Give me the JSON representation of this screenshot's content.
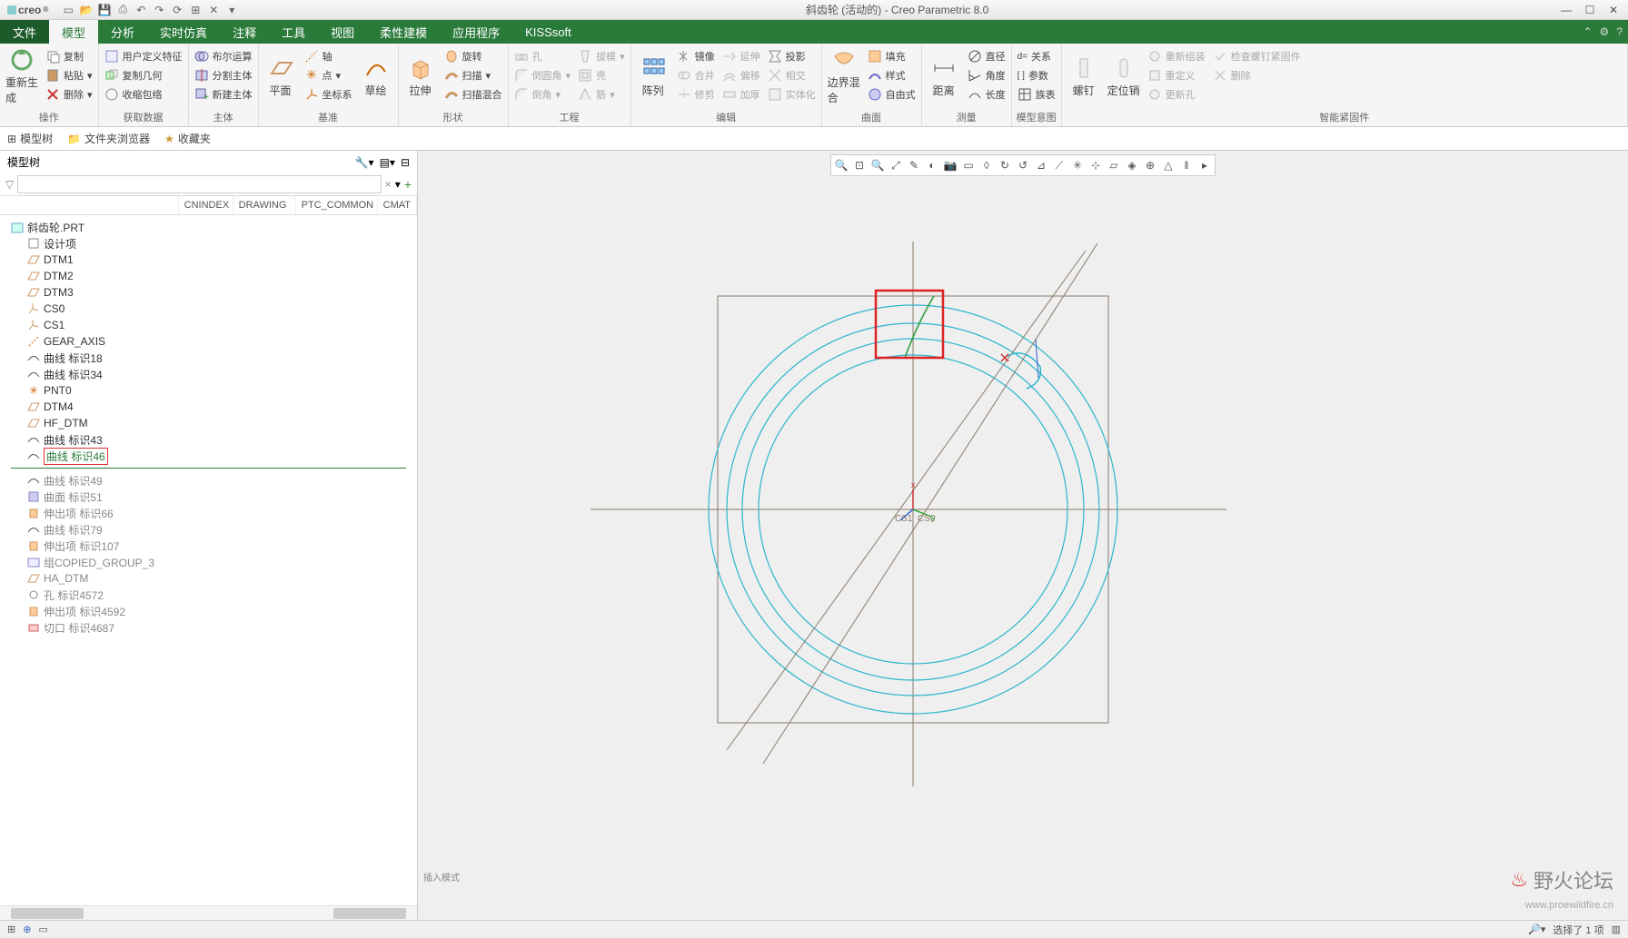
{
  "titlebar": {
    "logo": "creo",
    "title": "斜齿轮 (活动的) - Creo Parametric 8.0"
  },
  "tabs": [
    "文件",
    "模型",
    "分析",
    "实时仿真",
    "注释",
    "工具",
    "视图",
    "柔性建模",
    "应用程序",
    "KISSsoft"
  ],
  "active_tab_index": 1,
  "ribbon": {
    "g1": {
      "big": "重新生成",
      "i1": "复制",
      "i2": "粘贴",
      "i3": "删除",
      "label": "操作"
    },
    "g2": {
      "i1": "用户定义特征",
      "i2": "复制几何",
      "i3": "收缩包络",
      "label": "获取数据"
    },
    "g3": {
      "i1": "布尔运算",
      "i2": "分割主体",
      "i3": "新建主体",
      "label": "主体"
    },
    "g4": {
      "big": "平面",
      "i1": "轴",
      "i2": "点",
      "i3": "坐标系",
      "big2": "草绘",
      "label": "基准"
    },
    "g5": {
      "big": "拉伸",
      "i1": "旋转",
      "i2": "扫描",
      "i3": "扫描混合",
      "label": "形状"
    },
    "g6": {
      "i1": "孔",
      "i2": "倒圆角",
      "i3": "倒角",
      "i4": "拔模",
      "i5": "壳",
      "i6": "筋",
      "label": "工程"
    },
    "g7": {
      "big": "阵列",
      "i1": "镜像",
      "i2": "合并",
      "i3": "修剪",
      "i4": "延伸",
      "i5": "偏移",
      "i6": "加厚",
      "i7": "投影",
      "i8": "相交",
      "i9": "实体化",
      "label": "编辑"
    },
    "g8": {
      "big": "边界混合",
      "i1": "填充",
      "i2": "样式",
      "i3": "自由式",
      "label": "曲面"
    },
    "g9": {
      "big": "距离",
      "i1": "直径",
      "i2": "角度",
      "i3": "长度",
      "label": "测量"
    },
    "g10": {
      "i1": "关系",
      "i2": "参数",
      "i3": "族表",
      "label": "模型意图"
    },
    "g11": {
      "big1": "螺钉",
      "big2": "定位销",
      "i1": "重新组装",
      "i2": "重定义",
      "i3": "检查螺钉紧固件",
      "i4": "删除",
      "i5": "更新孔",
      "label": "智能紧固件"
    }
  },
  "nav": {
    "i1": "模型树",
    "i2": "文件夹浏览器",
    "i3": "收藏夹"
  },
  "sidebar": {
    "title": "模型树",
    "columns": [
      "CNINDEX",
      "DRAWING",
      "PTC_COMMON",
      "CMAT"
    ],
    "root": "斜齿轮.PRT",
    "items": [
      {
        "t": "设计项",
        "lv": 1
      },
      {
        "t": "DTM1",
        "lv": 1,
        "ic": "datum"
      },
      {
        "t": "DTM2",
        "lv": 1,
        "ic": "datum"
      },
      {
        "t": "DTM3",
        "lv": 1,
        "ic": "datum"
      },
      {
        "t": "CS0",
        "lv": 1,
        "ic": "csys"
      },
      {
        "t": "CS1",
        "lv": 1,
        "ic": "csys"
      },
      {
        "t": "GEAR_AXIS",
        "lv": 1,
        "ic": "axis"
      },
      {
        "t": "曲线 标识18",
        "lv": 1,
        "ic": "curve"
      },
      {
        "t": "曲线 标识34",
        "lv": 1,
        "ic": "curve"
      },
      {
        "t": "PNT0",
        "lv": 1,
        "ic": "point"
      },
      {
        "t": "DTM4",
        "lv": 1,
        "ic": "datum"
      },
      {
        "t": "HF_DTM",
        "lv": 1,
        "ic": "datum"
      },
      {
        "t": "曲线 标识43",
        "lv": 1,
        "ic": "curve"
      },
      {
        "t": "曲线 标识46",
        "lv": 1,
        "ic": "curve",
        "sel": true
      }
    ],
    "grey_items": [
      {
        "t": "曲线 标识49",
        "ic": "curve"
      },
      {
        "t": "曲面 标识51",
        "ic": "surf"
      },
      {
        "t": "伸出项 标识66",
        "ic": "ext"
      },
      {
        "t": "曲线 标识79",
        "ic": "curve"
      },
      {
        "t": "伸出项 标识107",
        "ic": "ext"
      },
      {
        "t": "组COPIED_GROUP_3",
        "ic": "group"
      },
      {
        "t": "HA_DTM",
        "ic": "datum"
      },
      {
        "t": "孔 标识4572",
        "ic": "hole"
      },
      {
        "t": "伸出项 标识4592",
        "ic": "ext"
      },
      {
        "t": "切口 标识4687",
        "ic": "cut"
      }
    ]
  },
  "canvas": {
    "cs": "CS0",
    "cs1": "CS1",
    "hint": "插入模式"
  },
  "status": {
    "sel": "选择了 1 项"
  },
  "watermark": {
    "text": "野火论坛",
    "link": "www.proewildfire.cn"
  }
}
